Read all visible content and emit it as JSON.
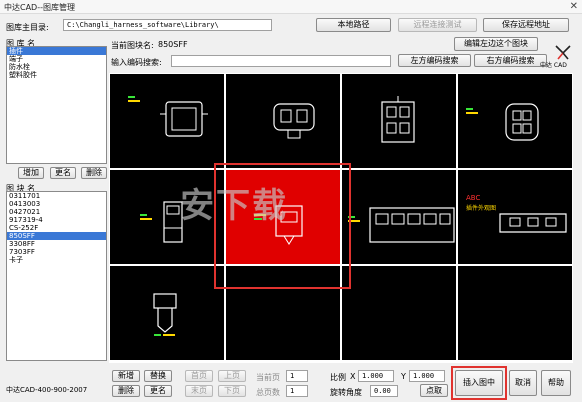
{
  "window": {
    "title": "中达CAD--图库管理",
    "close_glyph": "✕"
  },
  "library": {
    "root_label": "图库主目录:",
    "root_path": "C:\\Changli_harness_software\\Library\\",
    "name_label": "图 库 名"
  },
  "library_list": [
    "插件",
    "端子",
    "防水栓",
    "塑料胶件"
  ],
  "buttons_top": {
    "local_path": "本地路径",
    "remote_test": "远程连接测试",
    "save_remote": "保存远程地址"
  },
  "current": {
    "label": "当前图块名:",
    "value": "850SFF"
  },
  "edit_left_block": "编辑左边这个图块",
  "search": {
    "label": "输入编码搜索:",
    "value": "",
    "left_match": "左方编码搜索",
    "right_match": "右方编码搜索"
  },
  "logo": {
    "text": "中达 CAD"
  },
  "library_buttons": {
    "add": "增加",
    "rename": "更名",
    "delete": "删除"
  },
  "block": {
    "name_label": "图 块 名",
    "items": [
      "0311701",
      "0413003",
      "0427021",
      "917319-4",
      "CS-252F",
      "850SFF",
      "3308FF",
      "7303FF",
      "卡子"
    ]
  },
  "bottom_left": {
    "new": "新增",
    "replace": "替换",
    "delete": "删除",
    "rename": "更名"
  },
  "paging": {
    "first": "首页",
    "prev": "上页",
    "last": "末页",
    "next": "下页",
    "cur_page_label": "当前页",
    "cur_page": "1",
    "total_label": "总页数",
    "total": "1"
  },
  "scale": {
    "label": "比例",
    "x_label": "X",
    "x_value": "1.000",
    "y_label": "Y",
    "y_value": "1.000"
  },
  "rotation": {
    "label": "旋转角度",
    "value": "0.00"
  },
  "pick_button": "点取",
  "insert_button": "插入图中",
  "cancel_button": "取消",
  "help_button": "帮助",
  "phone": "中达CAD-400-900-2007",
  "watermark": "安下载",
  "thumb_labels": {
    "red_tag": "ABC",
    "note": "插件外观图"
  },
  "colors": {
    "accent_red": "#e0332f",
    "selection_blue": "#3a78d6",
    "cad_green": "#39e639",
    "cad_yellow": "#ffd800"
  }
}
